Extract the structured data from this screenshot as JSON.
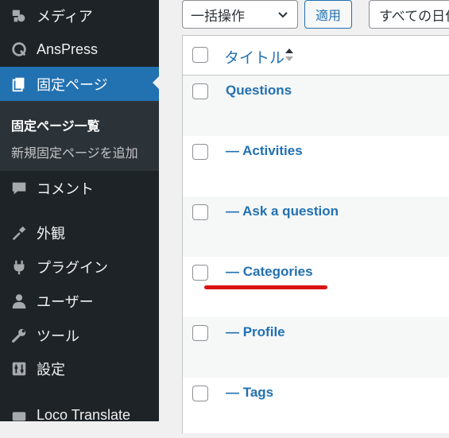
{
  "sidebar": {
    "items": [
      {
        "label": "メディア",
        "icon": "media-icon"
      },
      {
        "label": "AnsPress",
        "icon": "anspress-icon"
      },
      {
        "label": "固定ページ",
        "icon": "pages-icon",
        "active": true
      },
      {
        "label": "コメント",
        "icon": "comment-icon"
      },
      {
        "label": "外観",
        "icon": "appearance-icon"
      },
      {
        "label": "プラグイン",
        "icon": "plugin-icon"
      },
      {
        "label": "ユーザー",
        "icon": "users-icon"
      },
      {
        "label": "ツール",
        "icon": "tools-icon"
      },
      {
        "label": "設定",
        "icon": "settings-icon"
      },
      {
        "label": "Loco Translate",
        "icon": "loco-icon"
      }
    ],
    "submenu": [
      {
        "label": "固定ページ一覧",
        "current": true
      },
      {
        "label": "新規固定ページを追加"
      }
    ]
  },
  "toolbar": {
    "bulk_action": "一括操作",
    "apply_label": "適用",
    "date_filter": "すべての日付"
  },
  "table": {
    "header_title": "タイトル",
    "rows": [
      {
        "title": "Questions"
      },
      {
        "title": "— Activities"
      },
      {
        "title": "— Ask a question"
      },
      {
        "title": "— Categories"
      },
      {
        "title": "— Profile"
      },
      {
        "title": "— Tags"
      }
    ]
  },
  "colors": {
    "sidebar_bg": "#1d2327",
    "active_bg": "#2271b1",
    "link": "#2271b1",
    "annotation": "#d91414"
  }
}
